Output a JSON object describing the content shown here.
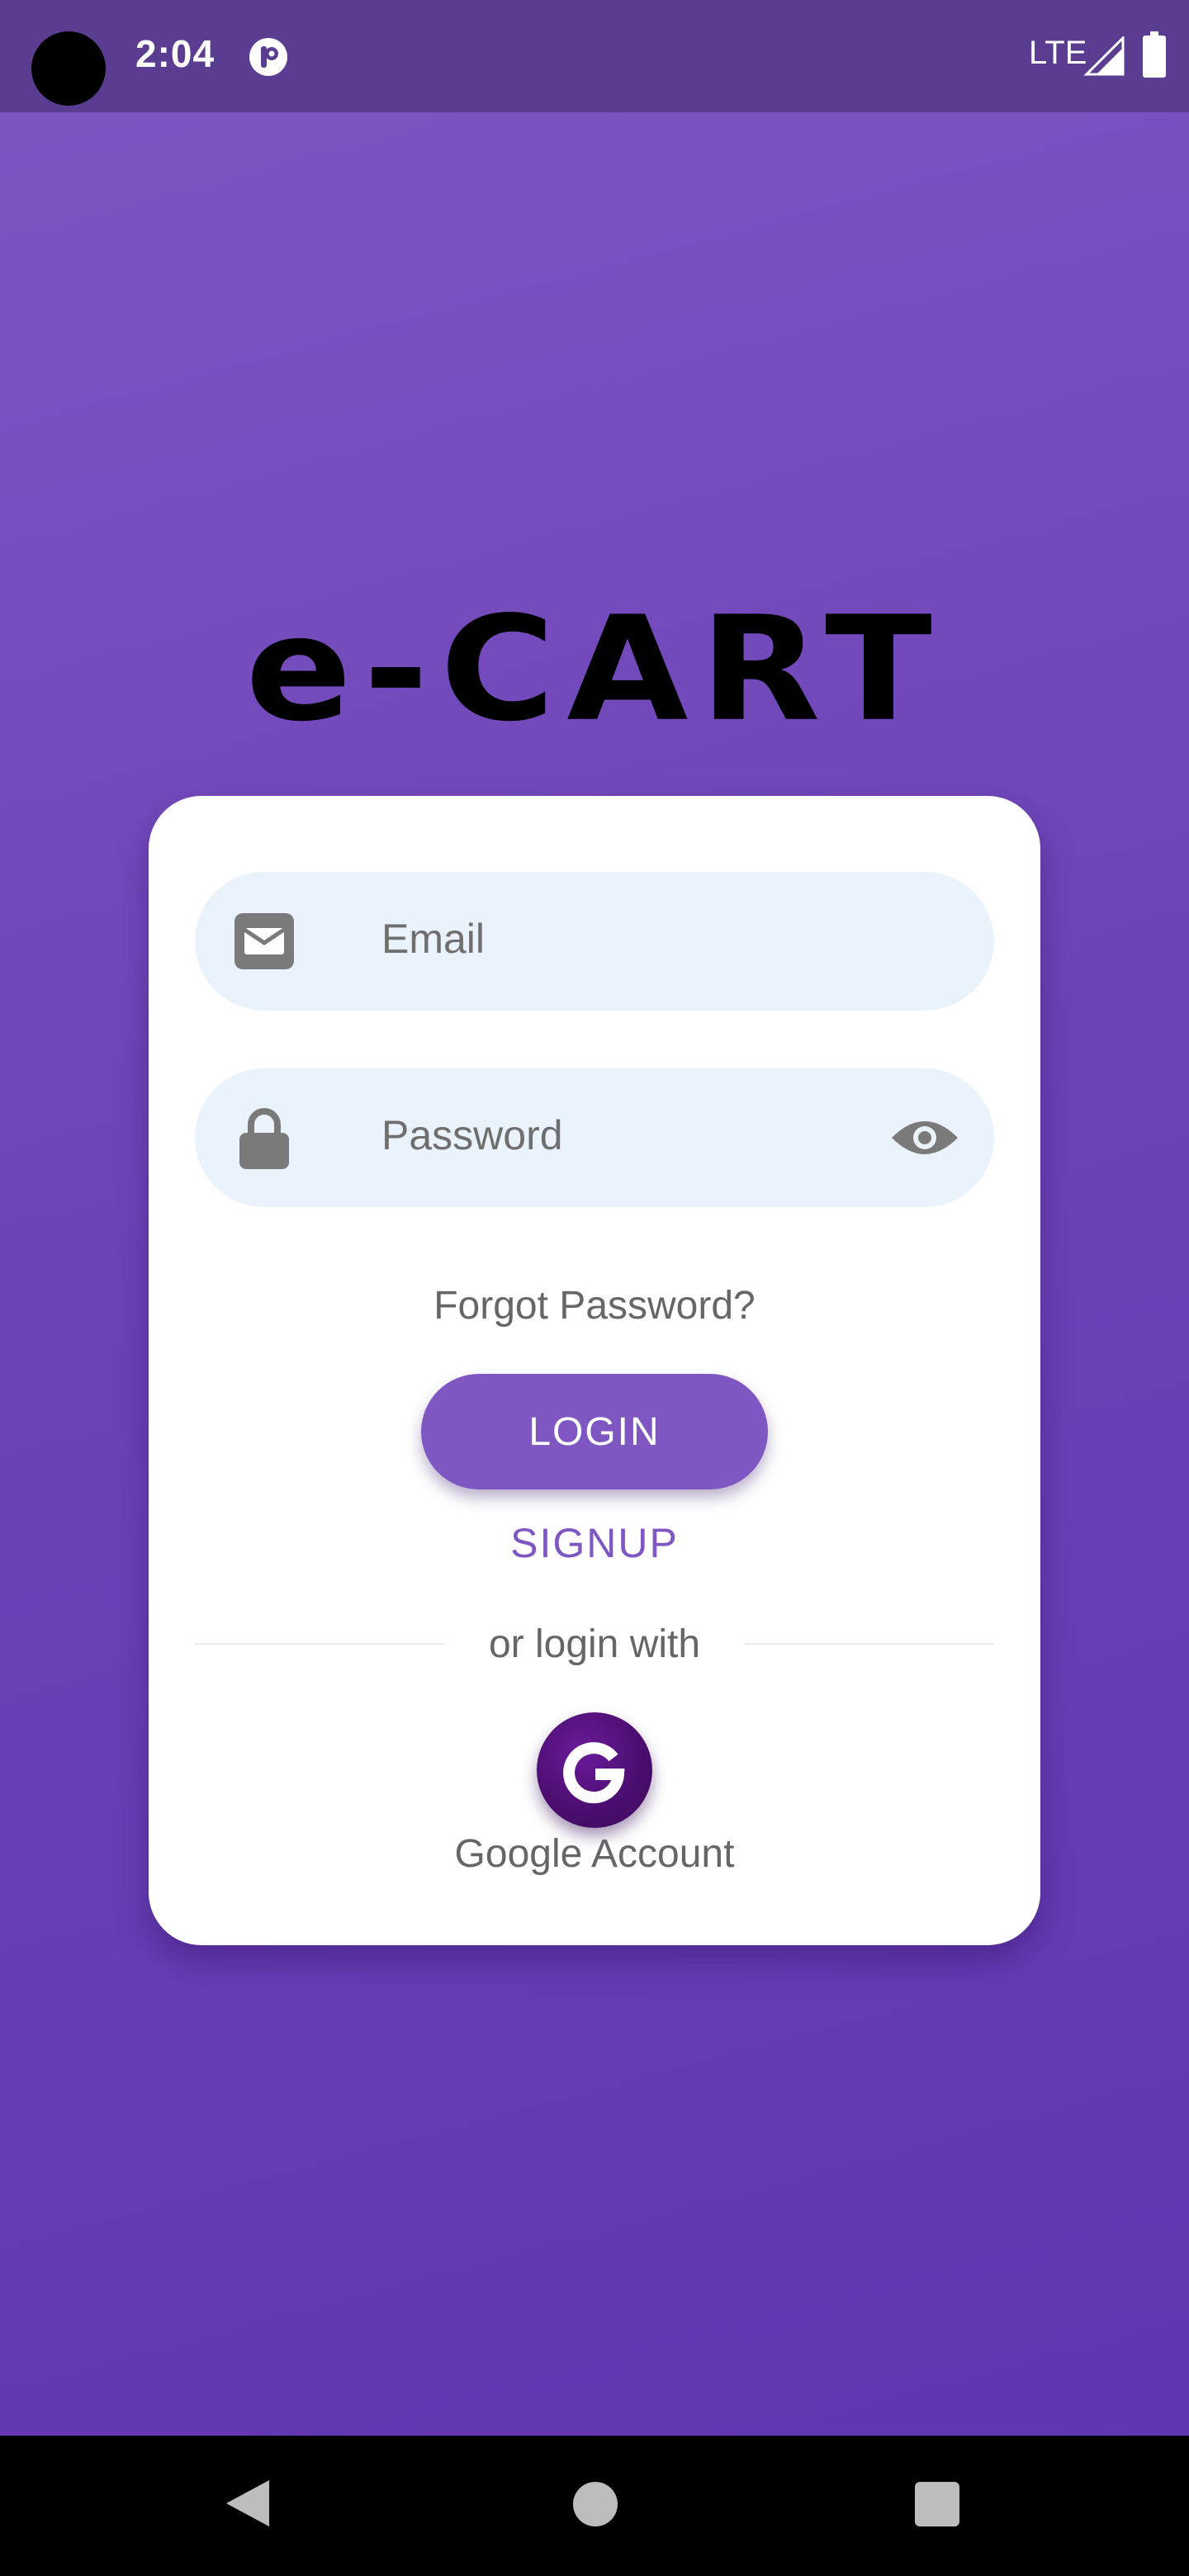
{
  "status_bar": {
    "time": "2:04",
    "network": "LTE",
    "icons": [
      "camera-cutout",
      "notification-icon",
      "signal-icon",
      "battery-icon"
    ]
  },
  "app": {
    "logo": "e-CART"
  },
  "login_form": {
    "email_placeholder": "Email",
    "password_placeholder": "Password",
    "forgot_password": "Forgot Password?",
    "login_label": "LOGIN",
    "signup_label": "SIGNUP",
    "divider_text": "or login with",
    "google_label": "Google Account",
    "google_glyph": "G"
  },
  "colors": {
    "accent": "#7e57c2",
    "field_bg": "#eaf2fb",
    "google_button": "#4a0d6e",
    "status_bar": "#5a3d91"
  },
  "nav_bar": {
    "icons": [
      "back-icon",
      "home-icon",
      "recents-icon"
    ]
  }
}
